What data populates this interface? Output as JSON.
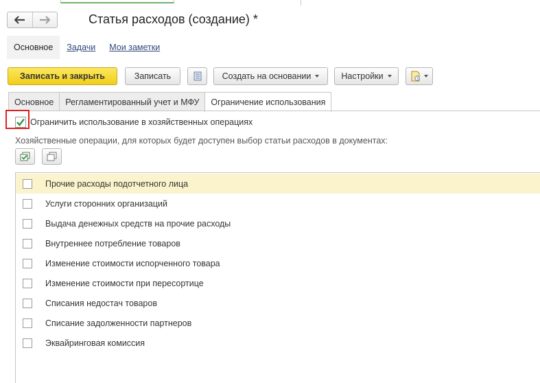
{
  "window": {
    "title": "Статья расходов (создание) *"
  },
  "nav": {
    "back_glyph": "🡐",
    "forward_glyph": "🡒"
  },
  "sections": [
    {
      "label": "Основное",
      "active": true
    },
    {
      "label": "Задачи",
      "active": false
    },
    {
      "label": "Мои заметки",
      "active": false
    }
  ],
  "toolbar": {
    "save_close_label": "Записать и закрыть",
    "save_label": "Записать",
    "create_based_label": "Создать на основании",
    "settings_label": "Настройки"
  },
  "tabs": [
    {
      "label": "Основное",
      "active": false
    },
    {
      "label": "Регламентированный учет и МФУ",
      "active": false
    },
    {
      "label": "Ограничение использования",
      "active": true
    }
  ],
  "restriction": {
    "checkbox_label": "Ограничить использование в хозяйственных операциях",
    "checked": true,
    "caption": "Хозяйственные операции, для которых будет доступен выбор статьи расходов в документах:"
  },
  "operations": [
    {
      "label": "Прочие расходы подотчетного лица",
      "checked": false,
      "selected": true
    },
    {
      "label": "Услуги сторонних организаций",
      "checked": false,
      "selected": false
    },
    {
      "label": "Выдача денежных средств на прочие расходы",
      "checked": false,
      "selected": false
    },
    {
      "label": "Внутреннее потребление товаров",
      "checked": false,
      "selected": false
    },
    {
      "label": "Изменение стоимости испорченного товара",
      "checked": false,
      "selected": false
    },
    {
      "label": "Изменение стоимости при пересортице",
      "checked": false,
      "selected": false
    },
    {
      "label": "Списания недостач товаров",
      "checked": false,
      "selected": false
    },
    {
      "label": "Списание задолженности партнеров",
      "checked": false,
      "selected": false
    },
    {
      "label": "Эквайринговая комиссия",
      "checked": false,
      "selected": false
    }
  ],
  "colors": {
    "primary_button": "#f2cd19",
    "selected_row": "#fbf3cb",
    "check_mark": "#2f9a3c",
    "highlight": "#e02020"
  }
}
